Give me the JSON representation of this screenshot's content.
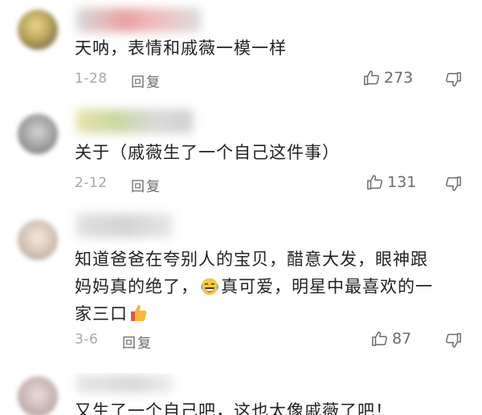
{
  "comments": [
    {
      "text": "天呐，表情和戚薇一模一样",
      "date": "1-28",
      "reply_label": "回复",
      "likes": "273"
    },
    {
      "text": "关于（戚薇生了一个自己这件事）",
      "date": "2-12",
      "reply_label": "回复",
      "likes": "131"
    },
    {
      "text_line1": "知道爸爸在夸别人的宝贝，醋意大发，眼神跟",
      "text_line2a": "妈妈真的绝了，",
      "text_line2b": "真可爱，明星中最喜欢的一",
      "text_line3": "家三口",
      "date": "3-6",
      "reply_label": "回复",
      "likes": "87"
    },
    {
      "text": "又生了一个自己吧，这也太像戚薇了吧！"
    }
  ],
  "icons": {
    "like": "thumbs-up-outline-icon",
    "dislike": "thumbs-down-outline-icon",
    "emoji_laugh": "tears-of-joy-emoji-icon",
    "emoji_thumbs": "thumbs-up-emoji-icon"
  },
  "colors": {
    "meta": "#a6a6a6",
    "action": "#6b6b6b",
    "text": "#222222"
  }
}
